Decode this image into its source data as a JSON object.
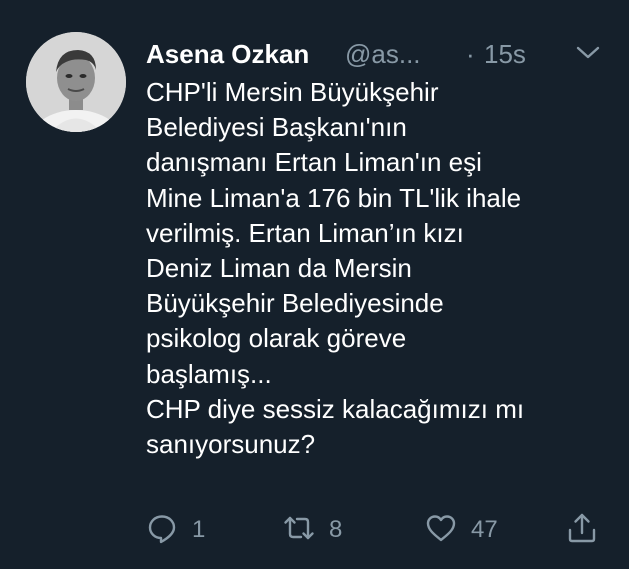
{
  "tweet": {
    "author_name": "Asena Ozkan",
    "author_handle": "@as...",
    "separator": "·",
    "time": "15s",
    "lines": [
      "CHP'li Mersin Büyükşehir",
      "Belediyesi Başkanı'nın",
      "danışmanı Ertan Liman'ın eşi",
      "Mine Liman'a 176 bin TL'lik ihale",
      "verilmiş. Ertan Liman’ın kızı",
      "Deniz Liman da Mersin",
      "Büyükşehir Belediyesinde",
      "psikolog olarak göreve",
      "başlamış...",
      "CHP diye sessiz kalacağımızı mı",
      "sanıyorsunuz?"
    ]
  },
  "actions": {
    "reply_count": "1",
    "retweet_count": "8",
    "like_count": "47"
  },
  "icons": {
    "menu": "chevron-down-icon",
    "reply": "reply-icon",
    "retweet": "retweet-icon",
    "like": "heart-icon",
    "share": "share-icon"
  },
  "colors": {
    "background": "#15202b",
    "text": "#ffffff",
    "secondary": "#8899a6"
  }
}
